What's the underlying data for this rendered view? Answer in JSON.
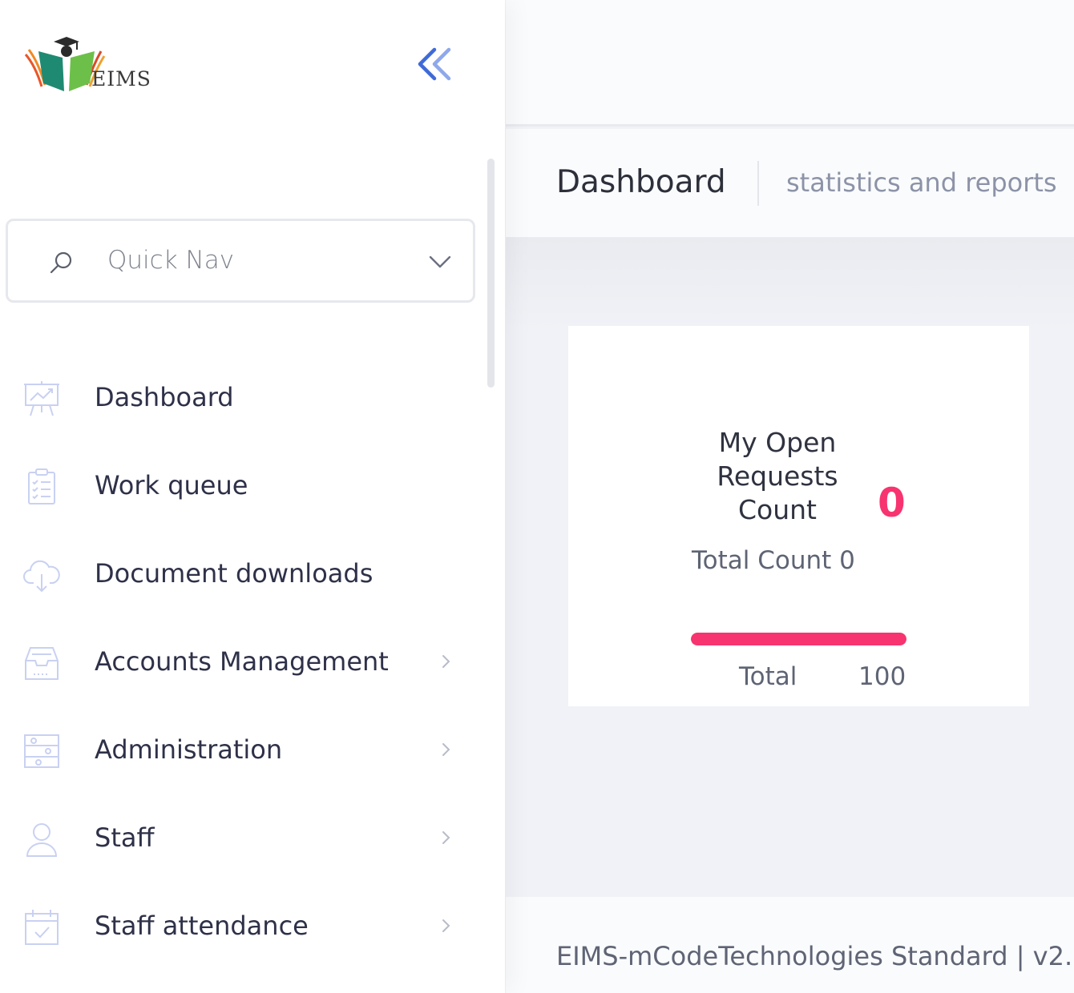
{
  "sidebar": {
    "logo_text": "EIMS",
    "collapse_icon": "double-chevron-left-icon",
    "quick_nav": {
      "label": "Quick Nav",
      "icon": "search-icon",
      "chevron": "chevron-down-icon"
    },
    "items": [
      {
        "label": "Dashboard",
        "icon": "presentation-chart-icon",
        "has_submenu": false
      },
      {
        "label": "Work queue",
        "icon": "clipboard-checklist-icon",
        "has_submenu": false
      },
      {
        "label": "Document downloads",
        "icon": "cloud-download-icon",
        "has_submenu": false
      },
      {
        "label": "Accounts Management",
        "icon": "inbox-tray-icon",
        "has_submenu": true
      },
      {
        "label": "Administration",
        "icon": "settings-sliders-icon",
        "has_submenu": true
      },
      {
        "label": "Staff",
        "icon": "user-icon",
        "has_submenu": true
      },
      {
        "label": "Staff attendance",
        "icon": "calendar-check-icon",
        "has_submenu": true
      }
    ]
  },
  "header": {
    "title": "Dashboard",
    "subtitle": "statistics and reports"
  },
  "widget": {
    "title_lines": [
      "My Open",
      "Requests",
      "Count"
    ],
    "value": "0",
    "total_count_text": "Total Count 0",
    "progress_percent": 100,
    "total_label": "Total",
    "total_value": "100"
  },
  "footer": {
    "text": "EIMS-mCodeTechnologies Standard | v2."
  },
  "colors": {
    "accent": "#f7346f",
    "collapse_icon": "#3f6ad8",
    "sidebar_icon": "#c9d1f2"
  }
}
